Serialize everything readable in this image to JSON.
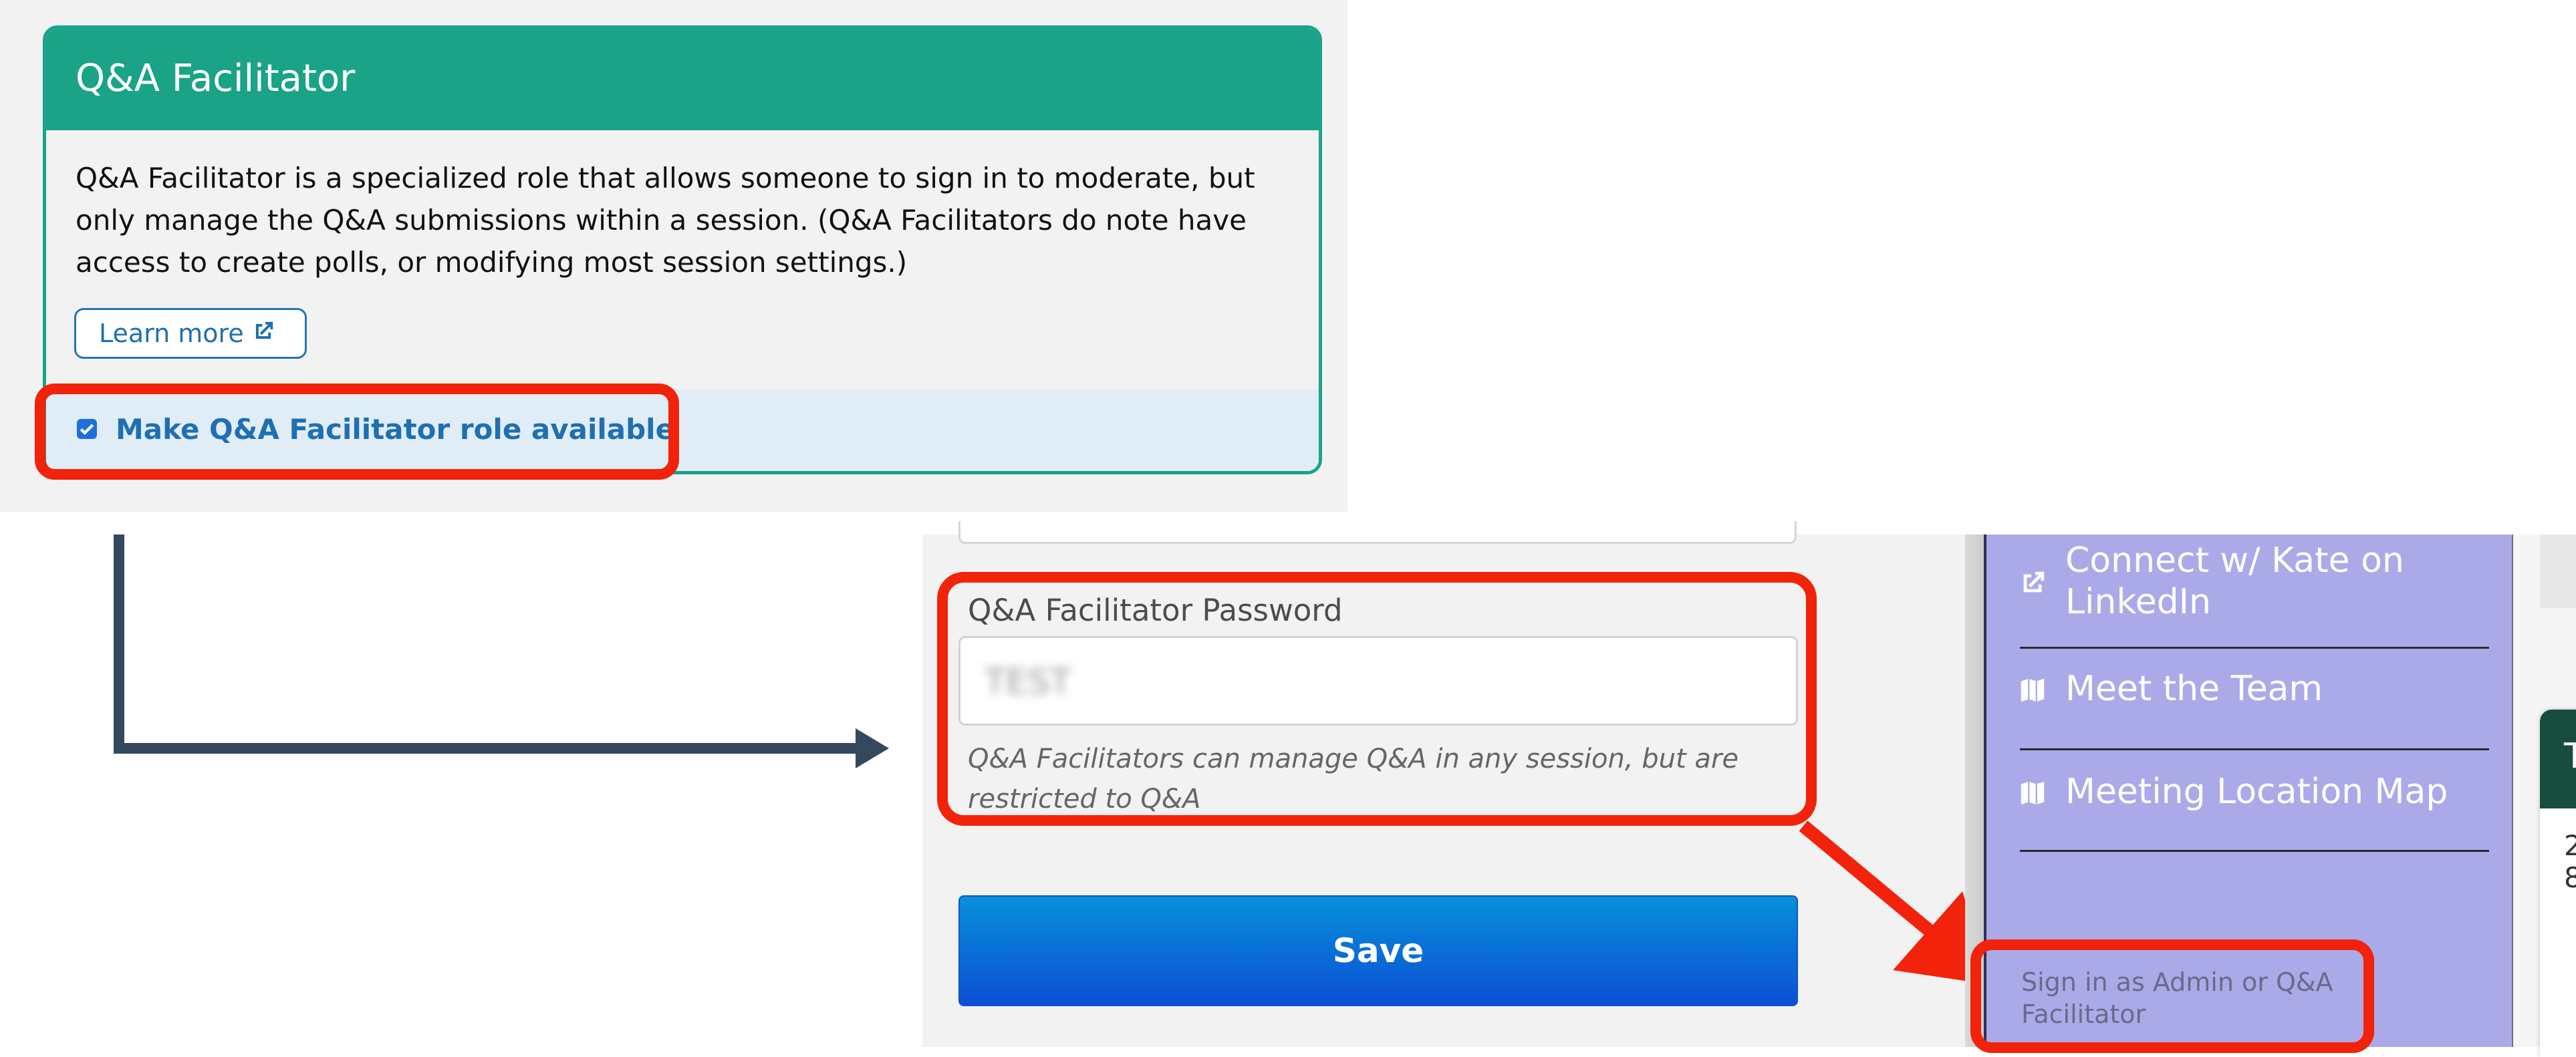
{
  "facilitator_card": {
    "title": "Q&A Facilitator",
    "description": "Q&A Facilitator is a specialized role that allows someone to sign in to moderate, but only manage the Q&A submissions within a session. (Q&A Facilitators do note have access to create polls, or modifying most session settings.)",
    "learn_more_label": "Learn more",
    "make_available_label": "Make Q&A Facilitator role available",
    "make_available_checked": true
  },
  "password_form": {
    "label": "Q&A Facilitator Password",
    "value": "TEST",
    "help_text": "Q&A Facilitators can manage Q&A in any session, but are restricted to Q&A",
    "save_label": "Save"
  },
  "sidebar": {
    "items": [
      {
        "label": "Connect w/ Kate on LinkedIn",
        "icon": "external-link-icon"
      },
      {
        "label": "Meet the Team",
        "icon": "map-icon"
      },
      {
        "label": "Meeting Location Map",
        "icon": "map-icon"
      }
    ],
    "sign_in_label": "Sign in as Admin or Q&A Facilitator"
  },
  "right_edge": {
    "text": "2\n8",
    "partial_text": "T"
  },
  "colors": {
    "accent_green": "#1aa386",
    "highlight_red": "#f2230a",
    "link_blue": "#1f6fb2",
    "sidebar_purple": "#aaaae9",
    "save_blue": "#0b4fd6"
  }
}
